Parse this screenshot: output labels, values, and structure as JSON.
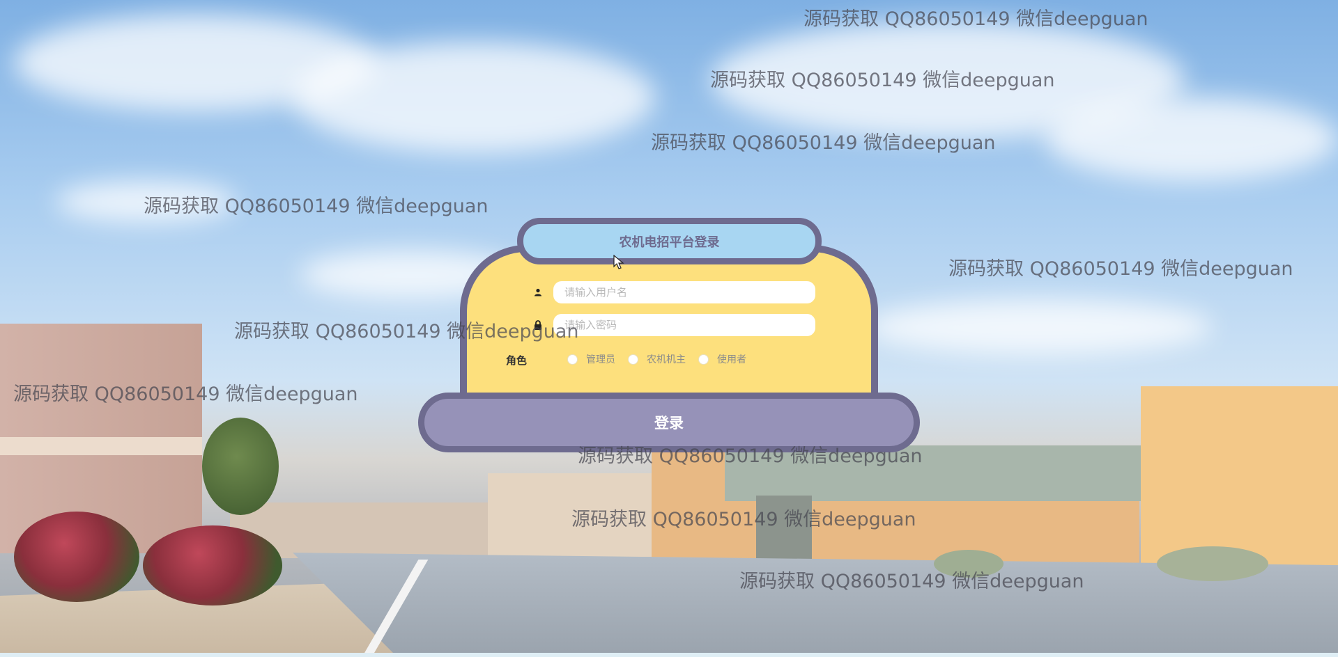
{
  "login": {
    "title": "农机电招平台登录",
    "username_placeholder": "请输入用户名",
    "password_placeholder": "请输入密码",
    "role_label": "角色",
    "roles": [
      "管理员",
      "农机机主",
      "使用者"
    ],
    "submit_label": "登录"
  },
  "watermark_text": "源码获取 QQ86050149 微信deepguan",
  "icons": [
    "user-icon",
    "lock-icon"
  ],
  "colors": {
    "card_fill": "#fde07d",
    "card_border": "#6e6b8f",
    "title_fill": "#a8d6f2",
    "button_fill": "#9692b8",
    "button_text": "#ffffff"
  }
}
